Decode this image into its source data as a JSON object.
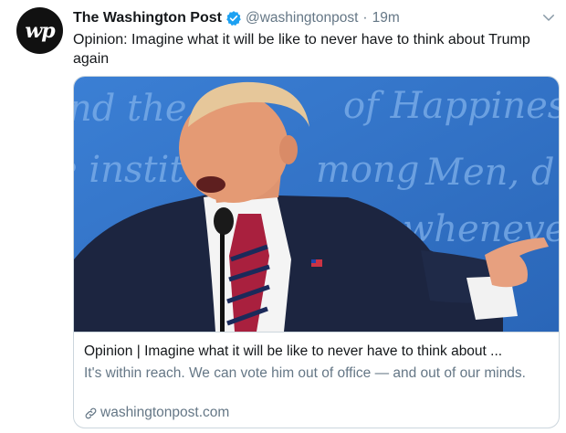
{
  "tweet": {
    "avatar_initials": "wp",
    "author_name": "The Washington Post",
    "handle": "@washingtonpost",
    "separator": "·",
    "time": "19m",
    "text": "Opinion: Imagine what it will be like to never have to think about Trump again"
  },
  "card": {
    "title": "Opinion | Imagine what it will be like to never have to think about ...",
    "description": "It's within reach. We can vote him out of office — and out of our minds.",
    "domain": "washingtonpost.com",
    "image_backdrop_text": [
      "nd the",
      "of Happines",
      "e instit",
      "mong",
      "Men, d",
      "whenever"
    ]
  },
  "icons": {
    "verified": "verified-badge-icon",
    "menu": "chevron-down-icon",
    "link": "link-icon"
  },
  "colors": {
    "verified": "#1da1f2",
    "secondary_text": "#657786",
    "border": "#ccd6dd",
    "backdrop_blue": "#2f72c8"
  }
}
